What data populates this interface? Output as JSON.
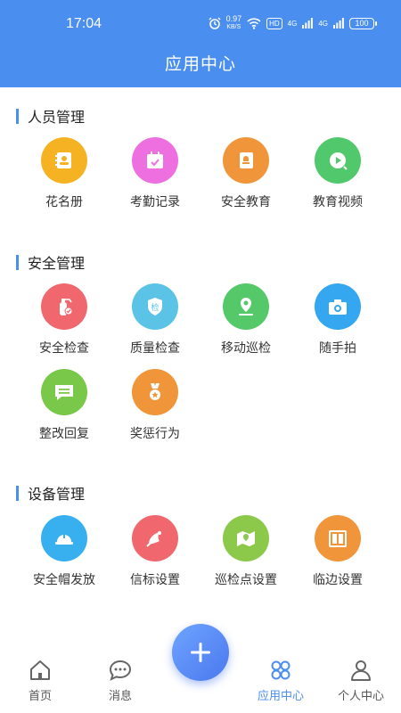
{
  "status_bar": {
    "time": "17:04",
    "net_speed_value": "0.97",
    "net_speed_unit": "KB/S",
    "hd": "HD",
    "signal1": "4G",
    "signal2": "4G",
    "battery": "100"
  },
  "header": {
    "title": "应用中心",
    "bg_color": "#4a8ef0"
  },
  "sections": [
    {
      "title": "人员管理",
      "apps": [
        {
          "label": "花名册",
          "icon": "roster-icon",
          "color": "#f5b324"
        },
        {
          "label": "考勤记录",
          "icon": "attendance-calendar-icon",
          "color": "#ee6fe0"
        },
        {
          "label": "安全教育",
          "icon": "safety-education-icon",
          "color": "#f0953a"
        },
        {
          "label": "教育视频",
          "icon": "video-play-icon",
          "color": "#52c86c"
        }
      ]
    },
    {
      "title": "安全管理",
      "apps": [
        {
          "label": "安全检查",
          "icon": "fire-extinguisher-icon",
          "color": "#f0686e"
        },
        {
          "label": "质量检查",
          "icon": "quality-inspection-icon",
          "color": "#5bc3e6"
        },
        {
          "label": "移动巡检",
          "icon": "location-pin-icon",
          "color": "#55c86a"
        },
        {
          "label": "随手拍",
          "icon": "camera-icon",
          "color": "#35a6f0"
        },
        {
          "label": "整改回复",
          "icon": "chat-reply-icon",
          "color": "#7ac84a"
        },
        {
          "label": "奖惩行为",
          "icon": "medal-icon",
          "color": "#f0953a"
        }
      ]
    },
    {
      "title": "设备管理",
      "apps": [
        {
          "label": "安全帽发放",
          "icon": "safety-helmet-icon",
          "color": "#38b0f0"
        },
        {
          "label": "信标设置",
          "icon": "beacon-icon",
          "color": "#f0686e"
        },
        {
          "label": "巡检点设置",
          "icon": "map-point-icon",
          "color": "#8cc84a"
        },
        {
          "label": "临边设置",
          "icon": "edge-barrier-icon",
          "color": "#f0953a"
        }
      ]
    }
  ],
  "tabbar": {
    "tabs": [
      {
        "label": "首页",
        "icon": "home-icon",
        "active": false
      },
      {
        "label": "消息",
        "icon": "message-icon",
        "active": false
      },
      {
        "label": "应用中心",
        "icon": "app-center-icon",
        "active": true
      },
      {
        "label": "个人中心",
        "icon": "profile-icon",
        "active": false
      }
    ],
    "fab_icon": "plus-icon",
    "active_color": "#4a8ef0"
  }
}
